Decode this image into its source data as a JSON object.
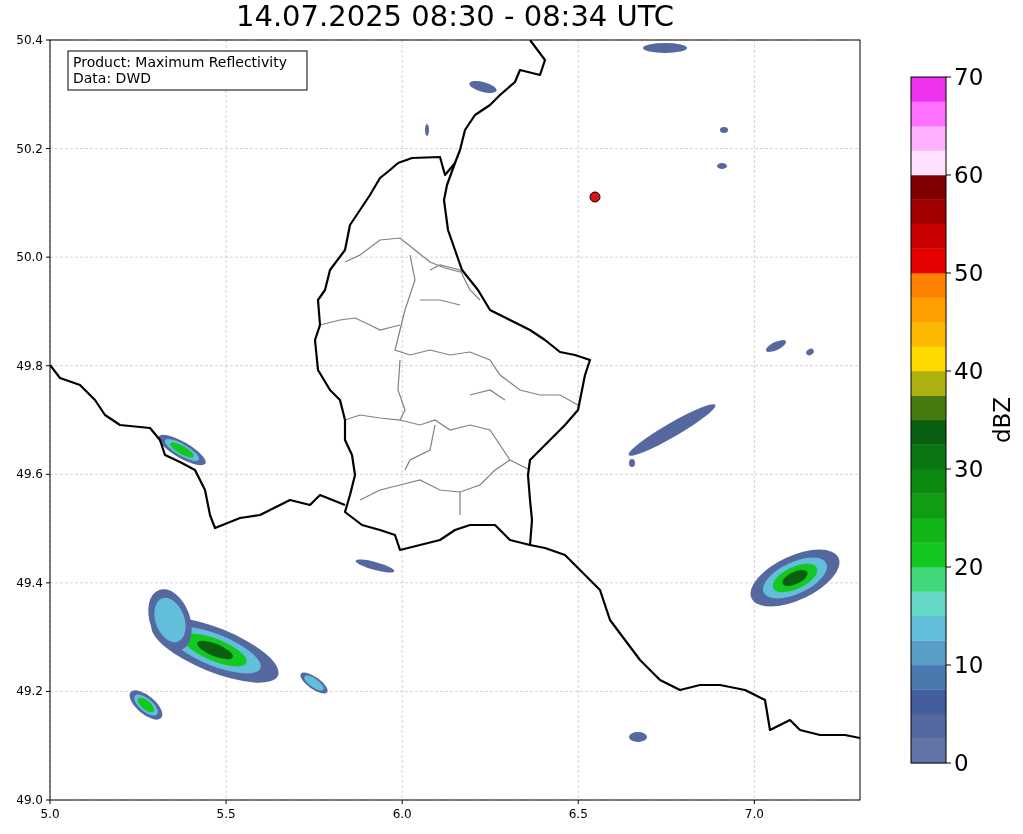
{
  "title": "14.07.2025 08:30 - 08:34 UTC",
  "legend": {
    "lines": [
      "Product: Maximum Reflectivity",
      "Data: DWD"
    ]
  },
  "map": {
    "x_ticks": [
      "5.0",
      "5.5",
      "6.0",
      "6.5",
      "7.0"
    ],
    "y_ticks": [
      "50.4",
      "50.2",
      "50.0",
      "49.8",
      "49.6",
      "49.4",
      "49.2",
      "49.0"
    ]
  },
  "colorbar": {
    "label": "dBZ",
    "ticks": [
      "70",
      "60",
      "50",
      "40",
      "30",
      "20",
      "10",
      "0"
    ],
    "bins": [
      {
        "color": "#6374a6"
      },
      {
        "color": "#55689f"
      },
      {
        "color": "#455c9e"
      },
      {
        "color": "#4a79b0"
      },
      {
        "color": "#5a9ec8"
      },
      {
        "color": "#62bedb"
      },
      {
        "color": "#66d8c6"
      },
      {
        "color": "#40d878"
      },
      {
        "color": "#13c81e"
      },
      {
        "color": "#12b41a"
      },
      {
        "color": "#109e15"
      },
      {
        "color": "#0d8a12"
      },
      {
        "color": "#0b7512"
      },
      {
        "color": "#0a5e10"
      },
      {
        "color": "#477a10"
      },
      {
        "color": "#b0b010"
      },
      {
        "color": "#ffd800"
      },
      {
        "color": "#ffb800"
      },
      {
        "color": "#ffa000"
      },
      {
        "color": "#ff8000"
      },
      {
        "color": "#e50000"
      },
      {
        "color": "#c80000"
      },
      {
        "color": "#a00000"
      },
      {
        "color": "#800000"
      },
      {
        "color": "#ffe0ff"
      },
      {
        "color": "#ffb0ff"
      },
      {
        "color": "#ff70ff"
      },
      {
        "color": "#ee33ee"
      }
    ]
  }
}
